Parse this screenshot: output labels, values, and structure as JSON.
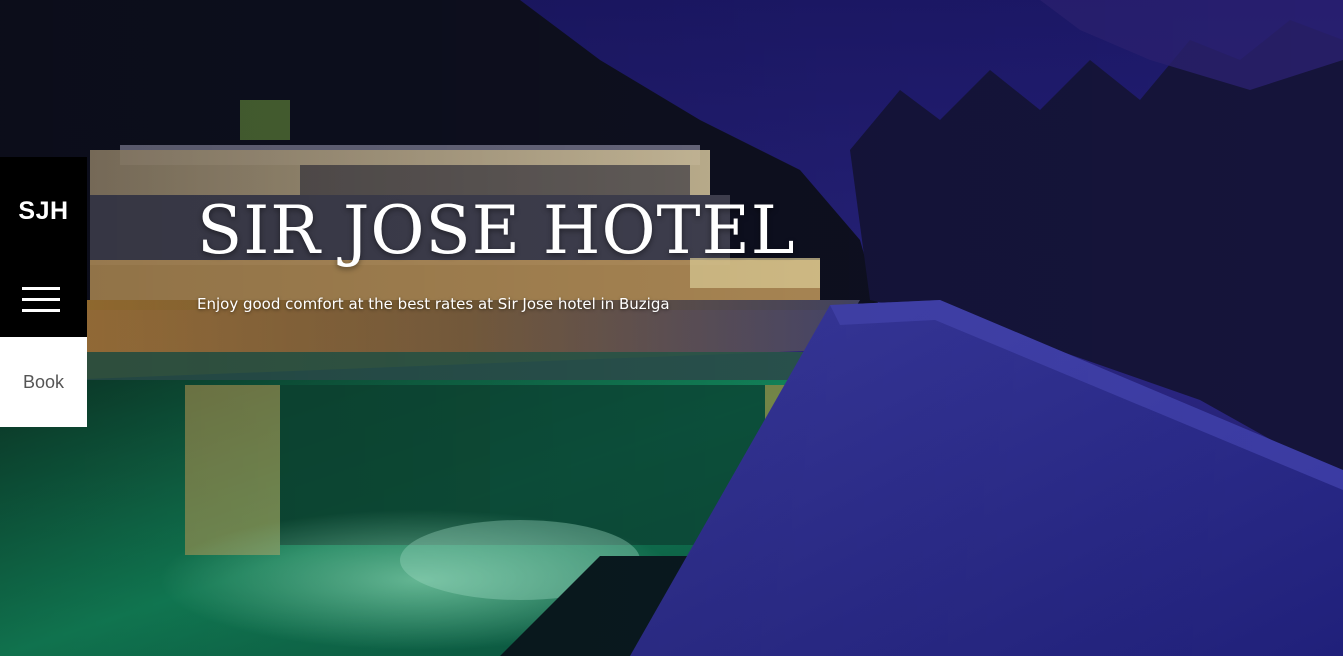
{
  "brand": {
    "logo_text": "SJH"
  },
  "nav": {
    "menu_icon": "hamburger-menu-icon",
    "book_label": "Book"
  },
  "hero": {
    "title": "SIR JOSE HOTEL",
    "subtitle": "Enjoy good comfort at the best rates at Sir Jose hotel in Buziga"
  },
  "colors": {
    "panel_dark": "#000000",
    "panel_light": "#ffffff",
    "text_light": "#ffffff",
    "book_text": "#555555",
    "sky": "#1a1660",
    "pool": "#0f6a4a",
    "snow_roof": "#2a2a8a"
  }
}
